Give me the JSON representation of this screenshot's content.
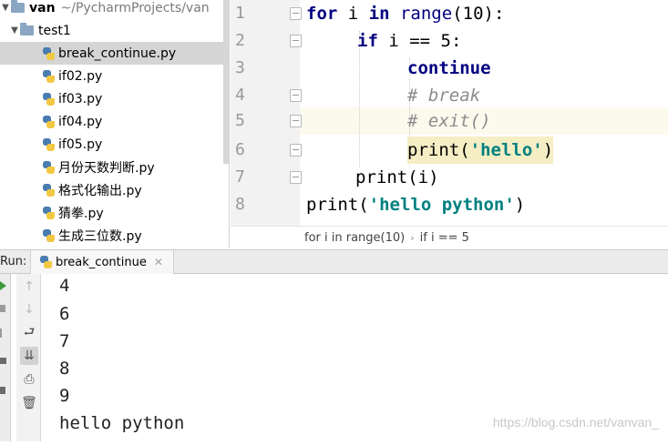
{
  "project": {
    "root_name": "van",
    "root_path": "~/PycharmProjects/van",
    "folder": "test1",
    "files": [
      "break_continue.py",
      "if02.py",
      "if03.py",
      "if04.py",
      "if05.py",
      "月份天数判断.py",
      "格式化输出.py",
      "猜拳.py",
      "生成三位数.py"
    ],
    "selected": "break_continue.py"
  },
  "editor": {
    "line_numbers": [
      "1",
      "2",
      "3",
      "4",
      "5",
      "6",
      "7",
      "8"
    ],
    "line1": {
      "kw1": "for",
      "var": " i ",
      "kw2": "in",
      "fn": " range",
      "rest": "(10):"
    },
    "line2": {
      "kw": "if",
      "rest": " i == 5:"
    },
    "line3": {
      "kw": "continue"
    },
    "line4": {
      "comment": "# break"
    },
    "line5": {
      "comment": "# exit()"
    },
    "line6": {
      "fn": "print(",
      "str": "'hello'",
      "close": ")"
    },
    "line7": {
      "code": "print(i)"
    },
    "line8": {
      "fn": "print(",
      "str": "'hello python'",
      "close": ")"
    }
  },
  "breadcrumb": {
    "item1": "for i in range(10)",
    "item2": "if i == 5"
  },
  "run": {
    "label": "Run:",
    "tab_name": "break_continue",
    "output": [
      "4",
      "6",
      "7",
      "8",
      "9",
      "hello python"
    ]
  },
  "watermark": "https://blog.csdn.net/vanvan_"
}
